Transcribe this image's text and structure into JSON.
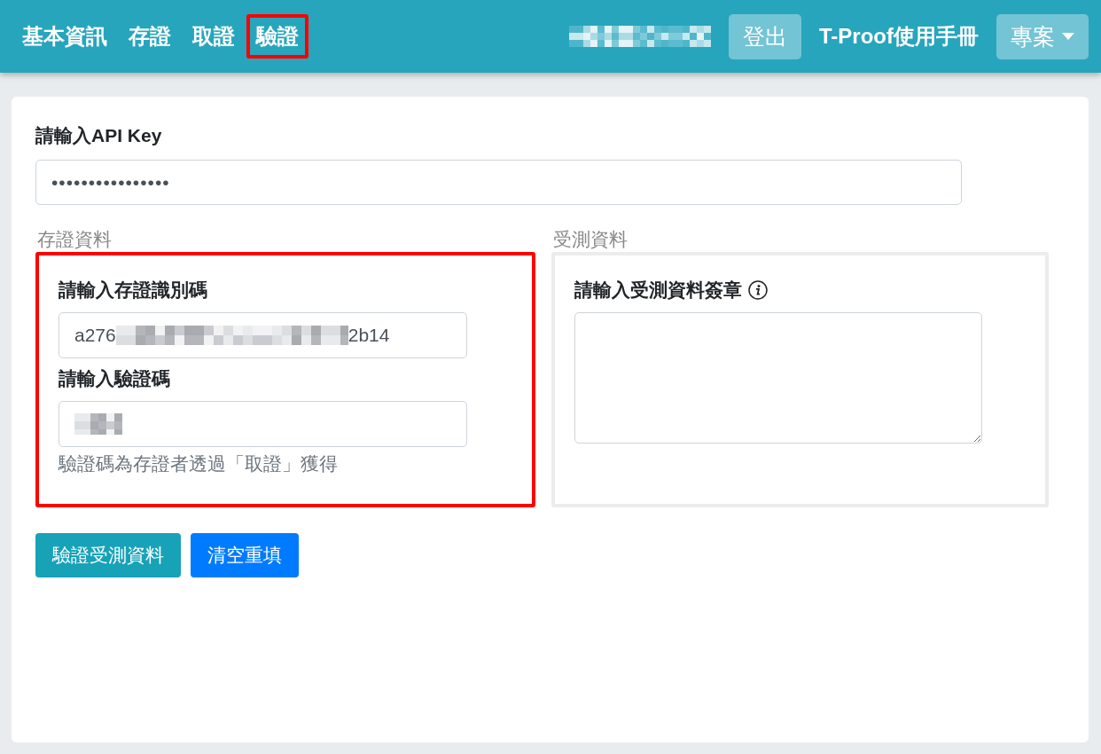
{
  "navbar": {
    "nav_items": [
      {
        "label": "基本資訊",
        "highlighted": false
      },
      {
        "label": "存證",
        "highlighted": false
      },
      {
        "label": "取證",
        "highlighted": false
      },
      {
        "label": "驗證",
        "highlighted": true
      }
    ],
    "user_name_redacted": true,
    "logout_button": "登出",
    "manual_link": "T-Proof使用手冊",
    "project_menu": "專案"
  },
  "api_key": {
    "label": "請輸入API Key",
    "value": "••••••••••••••••"
  },
  "panels": [
    {
      "legend": "存證資料",
      "highlighted": true,
      "fields": [
        {
          "kind": "input",
          "label": "請輸入存證識別碼",
          "value_start": "a276",
          "redacted": true,
          "value_end": "2b14"
        },
        {
          "kind": "input",
          "label": "請輸入驗證碼",
          "redacted": true,
          "help": "驗證碼為存證者透過「取證」獲得"
        }
      ]
    },
    {
      "legend": "受測資料",
      "highlighted": false,
      "fields": [
        {
          "kind": "textarea",
          "label": "請輸入受測資料簽章",
          "info": true
        }
      ]
    }
  ],
  "buttons": [
    {
      "label": "驗證受測資料",
      "color": "#17a2b8"
    },
    {
      "label": "清空重填",
      "color": "#007bff"
    }
  ]
}
